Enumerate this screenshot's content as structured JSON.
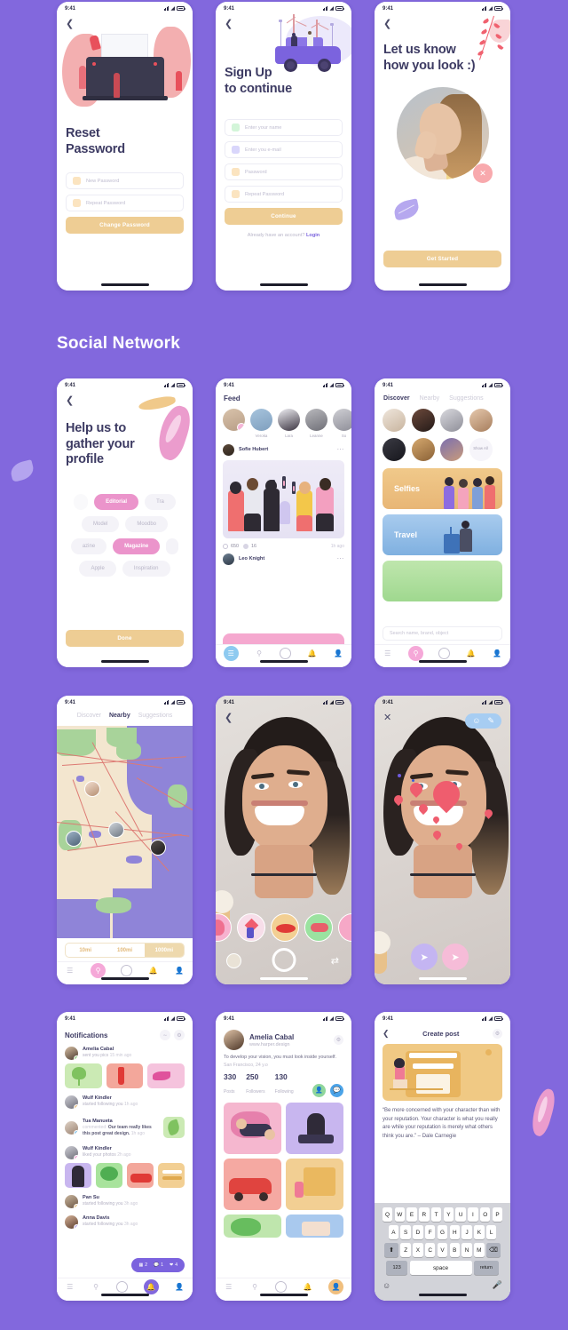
{
  "page": {
    "background_color": "#8268dd"
  },
  "section": {
    "title": "Social Network"
  },
  "status_bar": {
    "time": "9:41"
  },
  "screens": {
    "reset_password": {
      "title": "Reset\nPassword",
      "title_line1": "Reset",
      "title_line2": "Password",
      "fields": [
        {
          "placeholder": "New Password",
          "icon": "lock-icon"
        },
        {
          "placeholder": "Repeat Password",
          "icon": "lock-icon"
        }
      ],
      "button": "Change Password",
      "back_icon": "chevron-left-icon"
    },
    "sign_up": {
      "title_line1": "Sign Up",
      "title_line2": "to continue",
      "fields": [
        {
          "placeholder": "Enter your name",
          "icon": "user-icon"
        },
        {
          "placeholder": "Enter you e-mail",
          "icon": "mail-icon"
        },
        {
          "placeholder": "Password",
          "icon": "lock-icon"
        },
        {
          "placeholder": "Repeat Password",
          "icon": "lock-icon"
        }
      ],
      "button": "Continue",
      "footer_text": "Already have an account?",
      "footer_link": "Login"
    },
    "let_us_know": {
      "title_line1": "Let us know",
      "title_line2": "how you look :)",
      "button": "Get Started",
      "close_icon": "close-icon"
    },
    "gather_profile": {
      "title_line1": "Help us to",
      "title_line2": "gather your",
      "title_line3": "profile",
      "tags": [
        {
          "label": "Editorial",
          "selected": true
        },
        {
          "label": "Tra",
          "selected": false
        },
        {
          "label": "Model",
          "selected": false
        },
        {
          "label": "Moodbo",
          "selected": false
        },
        {
          "label": "azine",
          "selected": false
        },
        {
          "label": "Magazine",
          "selected": true
        },
        {
          "label": "Apple",
          "selected": false
        },
        {
          "label": "Inspiration",
          "selected": false
        }
      ],
      "button": "Done"
    },
    "feed": {
      "header": "Feed",
      "stories": [
        {
          "name": "",
          "has_add": true
        },
        {
          "name": "Veroka"
        },
        {
          "name": "Lara"
        },
        {
          "name": "Leanne"
        },
        {
          "name": "So"
        }
      ],
      "posts": [
        {
          "author": "Sofie Hubert",
          "likes": "650",
          "comments": "16",
          "time": "1h ago",
          "menu_icon": "more-icon"
        },
        {
          "author": "Leo Knight",
          "menu_icon": "more-icon"
        }
      ],
      "tabs": [
        {
          "icon": "menu-icon",
          "active": true
        },
        {
          "icon": "search-icon",
          "active": false
        },
        {
          "icon": "camera-icon",
          "active": false
        },
        {
          "icon": "bell-icon",
          "active": false
        },
        {
          "icon": "person-icon",
          "active": false
        }
      ]
    },
    "discover": {
      "segments": [
        {
          "label": "Discover",
          "active": true
        },
        {
          "label": "Nearby",
          "active": false
        },
        {
          "label": "Suggestions",
          "active": false
        }
      ],
      "show_all": "Show All",
      "categories": [
        {
          "label": "Selfies"
        },
        {
          "label": "Travel"
        },
        {
          "label": ""
        }
      ],
      "search_placeholder": "Search name, brand, object"
    },
    "nearby_map": {
      "segments": [
        {
          "label": "Discover",
          "active": false
        },
        {
          "label": "Nearby",
          "active": true
        },
        {
          "label": "Suggestions",
          "active": false
        }
      ],
      "distances": [
        {
          "label": "10mi",
          "active": false
        },
        {
          "label": "100mi",
          "active": false
        },
        {
          "label": "1000mi",
          "active": true
        }
      ]
    },
    "camera": {
      "back_icon": "chevron-left-icon",
      "shutter_icon": "shutter-icon",
      "swap_icon": "swap-camera-icon"
    },
    "camera_edit": {
      "close_icon": "close-icon",
      "tools": [
        {
          "icon": "smiley-icon"
        },
        {
          "icon": "pencil-icon"
        }
      ],
      "actions": [
        {
          "icon": "send-icon"
        },
        {
          "icon": "share-icon"
        }
      ]
    },
    "notifications": {
      "header": "Notifications",
      "header_icons": [
        {
          "icon": "filter-icon"
        },
        {
          "icon": "gear-icon"
        }
      ],
      "items": [
        {
          "name": "Amelia Cabal",
          "action": "sent you pics",
          "time": "15 min ago",
          "badge_color": "#9fd88f"
        },
        {
          "name": "Wulf Kindler",
          "action": "started following you",
          "time": "1h ago",
          "badge_color": "#f0c98a"
        },
        {
          "name": "Tua Manueta",
          "action_prefix": "commented:",
          "action": "Our team really likes this post great design.",
          "time": "1h ago",
          "badge_color": "#8ecaf0"
        },
        {
          "name": "Wulf Kindler",
          "action": "liked your photos",
          "time": "2h ago",
          "badge_color": "#f5a8d8"
        },
        {
          "name": "Pan Su",
          "action": "started following you",
          "time": "3h ago",
          "badge_color": "#f0c98a"
        },
        {
          "name": "Anna Davis",
          "action": "started following you",
          "time": "3h ago",
          "badge_color": "#c4b5f2"
        }
      ],
      "reaction_pill": [
        {
          "icon": "grid-icon",
          "count": "2"
        },
        {
          "icon": "comment-icon",
          "count": "1"
        },
        {
          "icon": "heart-icon",
          "count": "4"
        }
      ]
    },
    "profile": {
      "name": "Amelia Cabal",
      "url": "www.harper.design",
      "bio": "To develop your vision, you must look inside yourself.",
      "location": "San Francisco, 24 y.o",
      "stats": [
        {
          "value": "330",
          "label": "Posts"
        },
        {
          "value": "250",
          "label": "Followers"
        },
        {
          "value": "130",
          "label": "Following"
        }
      ],
      "actions": [
        {
          "icon": "add-person-icon",
          "color": "#8fd69b"
        },
        {
          "icon": "message-icon",
          "color": "#4ba3e8"
        }
      ],
      "gear_icon": "gear-icon"
    },
    "create_post": {
      "title": "Create post",
      "back_icon": "chevron-left-icon",
      "gear_icon": "gear-icon",
      "body": "“Be more concerned with your character than with your reputation. Your character is what you really are while your reputation is merely what others think you are.” – Dale Carnegie",
      "keyboard": {
        "row1": [
          "Q",
          "W",
          "E",
          "R",
          "T",
          "Y",
          "U",
          "I",
          "O",
          "P"
        ],
        "row2": [
          "A",
          "S",
          "D",
          "F",
          "G",
          "H",
          "J",
          "K",
          "L"
        ],
        "row3": [
          "Z",
          "X",
          "C",
          "V",
          "B",
          "N",
          "M"
        ],
        "shift": "⬆",
        "backspace": "⌫",
        "numbers": "123",
        "space": "space",
        "return": "return",
        "emoji_icon": "emoji-icon",
        "mic_icon": "microphone-icon"
      }
    }
  },
  "colors": {
    "background": "#8268dd",
    "accent_gold": "#eecd94",
    "accent_pink": "#eb94cb",
    "text_dark": "#3d3b63",
    "purple": "#7b63de"
  }
}
